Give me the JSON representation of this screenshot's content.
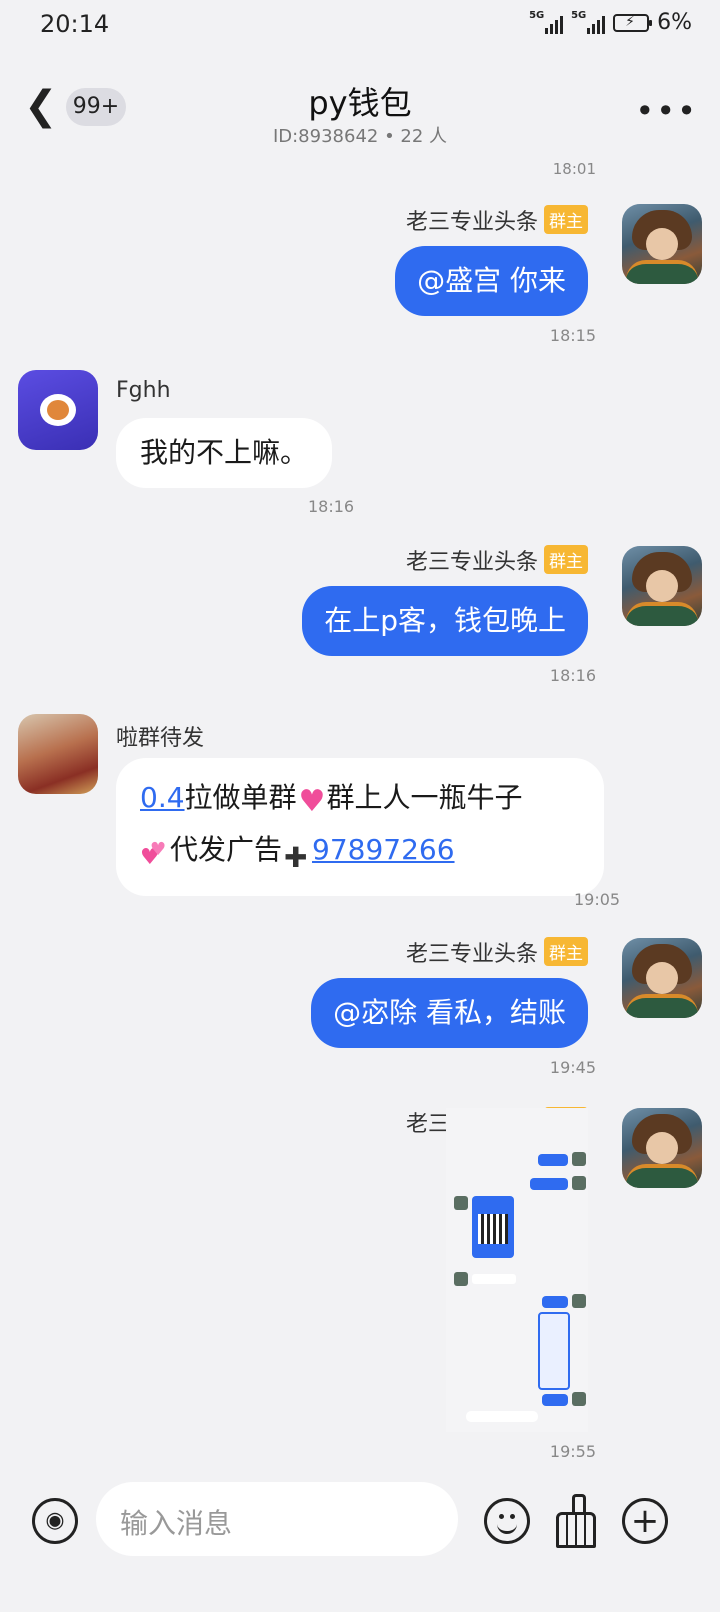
{
  "status": {
    "time": "20:14",
    "signal1": "5G",
    "signal2": "5G",
    "battery": "6%"
  },
  "header": {
    "unread": "99+",
    "title": "py钱包",
    "subtitle": "ID:8938642 • 22 人"
  },
  "chat": {
    "top_time": "18:01",
    "messages": [
      {
        "sender": "老三专业头条",
        "badge": "群主",
        "text": "@盛宫 你来",
        "time": "18:15"
      },
      {
        "sender": "Fghh",
        "text": "我的不上嘛。",
        "time": "18:16"
      },
      {
        "sender": "老三专业头条",
        "badge": "群主",
        "text": "在上p客，钱包晚上",
        "time": "18:16"
      },
      {
        "sender": "啦群待发",
        "text_parts": {
          "link1": "0.4",
          "part1": "拉做单群",
          "part2": "群上人一瓶牛子",
          "part3": "代发广告",
          "link2": "97897266"
        },
        "time": "19:05"
      },
      {
        "sender": "老三专业头条",
        "badge": "群主",
        "text": "@宓除 看私，结账",
        "time": "19:45"
      },
      {
        "sender": "老三专业头条",
        "badge": "群主",
        "image": "chat-screenshot-image",
        "time": "19:55"
      }
    ]
  },
  "composer": {
    "placeholder": "输入消息"
  },
  "icons": [
    "back-arrow-icon",
    "more-icon",
    "voice-icon",
    "emoji-icon",
    "broom-icon",
    "plus-icon"
  ],
  "colors": {
    "accent": "#2f6bf0",
    "badge": "#f7b733"
  }
}
